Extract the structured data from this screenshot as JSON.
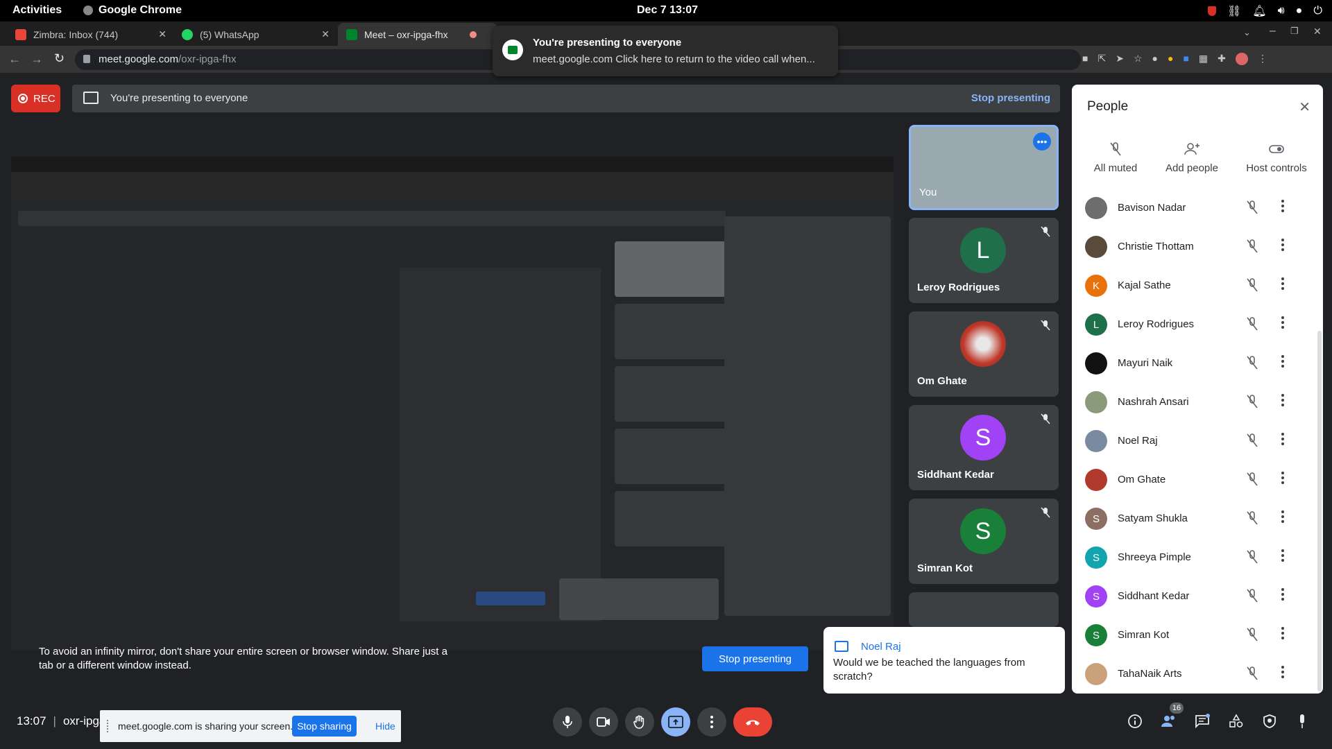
{
  "system": {
    "activities": "Activities",
    "app": "Google Chrome",
    "clock": "Dec 7  13:07"
  },
  "tabs": [
    {
      "title": "Zimbra: Inbox (744)",
      "color": "#e8453c"
    },
    {
      "title": "(5) WhatsApp",
      "color": "#25d366"
    },
    {
      "title": "Meet – oxr-ipga-fhx",
      "color": "#00832d"
    }
  ],
  "address": {
    "host": "meet.google.com",
    "path": "/oxr-ipga-fhx"
  },
  "notification": {
    "title": "You're presenting to everyone",
    "body": "meet.google.com  Click here to return to the video call when..."
  },
  "meet": {
    "rec_label": "REC",
    "banner_text": "You're presenting to everyone",
    "banner_stop": "Stop presenting",
    "tiles": [
      {
        "name": "You",
        "initial": "",
        "color": "#7a8a95"
      },
      {
        "name": "Leroy Rodrigues",
        "initial": "L",
        "color": "#1e6f4a"
      },
      {
        "name": "Om Ghate",
        "initial": "",
        "color": "#c0392b"
      },
      {
        "name": "Siddhant Kedar",
        "initial": "S",
        "color": "#a142f4"
      },
      {
        "name": "Simran Kot",
        "initial": "S",
        "color": "#188038"
      }
    ],
    "mirror_note": "To avoid an infinity mirror, don't share your entire screen or browser window. Share just a tab or a different window instead.",
    "stop_presenting": "Stop presenting",
    "chat": {
      "sender": "Noel Raj",
      "message": "Would we be teached the languages from scratch?"
    },
    "time": "13:07",
    "code": "oxr-ipga-fhx",
    "share_text": "meet.google.com is sharing your screen.",
    "stop_sharing": "Stop sharing",
    "hide": "Hide",
    "people_count": "16"
  },
  "people": {
    "title": "People",
    "actions": [
      "All muted",
      "Add people",
      "Host controls"
    ],
    "list": [
      {
        "name": "Bavison Nadar",
        "initial": "",
        "color": "#6d6d6d"
      },
      {
        "name": "Christie Thottam",
        "initial": "",
        "color": "#5a4a3a"
      },
      {
        "name": "Kajal Sathe",
        "initial": "K",
        "color": "#e8710a"
      },
      {
        "name": "Leroy Rodrigues",
        "initial": "L",
        "color": "#1e6f4a"
      },
      {
        "name": "Mayuri Naik",
        "initial": "",
        "color": "#111111"
      },
      {
        "name": "Nashrah Ansari",
        "initial": "",
        "color": "#8a9a7a"
      },
      {
        "name": "Noel Raj",
        "initial": "",
        "color": "#7a8aa0"
      },
      {
        "name": "Om Ghate",
        "initial": "",
        "color": "#b03a2e"
      },
      {
        "name": "Satyam Shukla",
        "initial": "S",
        "color": "#8d6e63"
      },
      {
        "name": "Shreeya Pimple",
        "initial": "S",
        "color": "#12a4af"
      },
      {
        "name": "Siddhant Kedar",
        "initial": "S",
        "color": "#a142f4"
      },
      {
        "name": "Simran Kot",
        "initial": "S",
        "color": "#188038"
      },
      {
        "name": "TahaNaik Arts",
        "initial": "",
        "color": "#c9a27a"
      }
    ]
  }
}
